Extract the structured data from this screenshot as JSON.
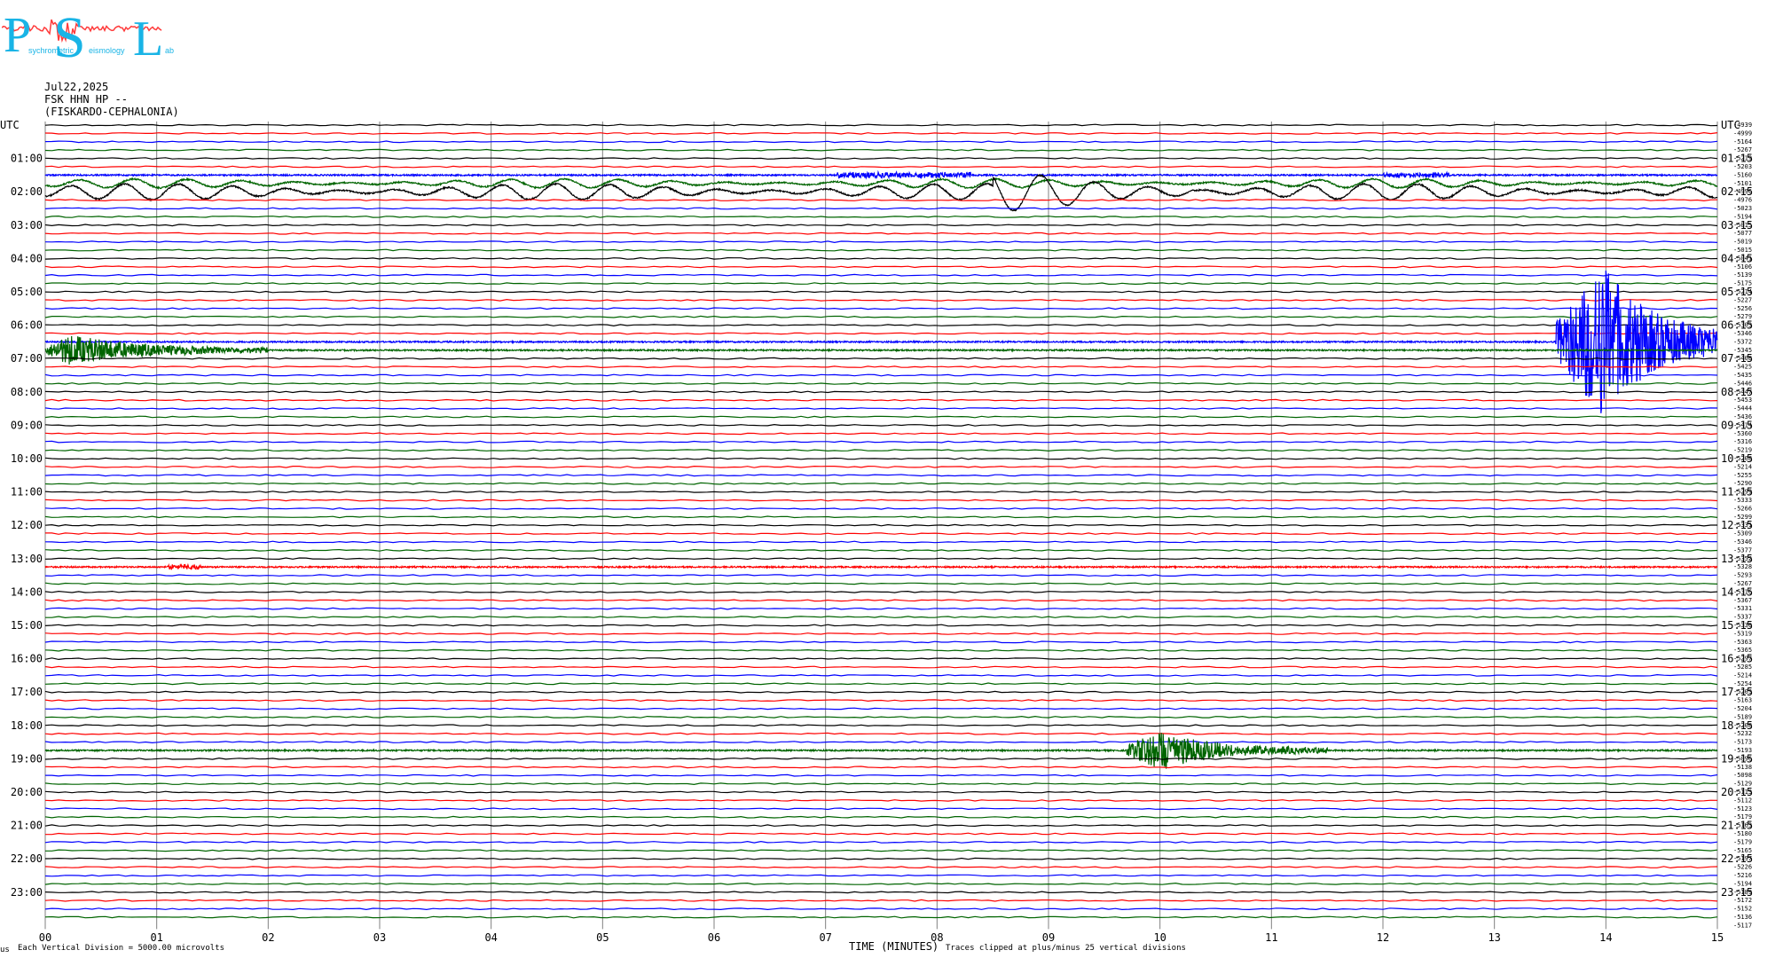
{
  "logo": {
    "letters": [
      "P",
      "S",
      "L"
    ],
    "words": [
      "sychrometric",
      "eismology",
      "ab"
    ]
  },
  "header": {
    "date": "Jul22,2025",
    "station": "FSK HHN HP --",
    "location": "(FISKARDO-CEPHALONIA)"
  },
  "utc_label": "UTC",
  "footer": {
    "scale": "Each Vertical Division = 5000.00 microvolts",
    "xlabel": "TIME (MINUTES)",
    "clip": "Traces clipped at plus/minus 25 vertical divisions",
    "corner": "us"
  },
  "colors": {
    "trace_cycle": [
      "#000000",
      "#ff0000",
      "#0000ff",
      "#006400"
    ],
    "grid": "#808080"
  },
  "chart_data": {
    "type": "line",
    "title": "",
    "xlabel": "TIME (MINUTES)",
    "xlim": [
      0,
      15
    ],
    "x_ticks": [
      "00",
      "01",
      "02",
      "03",
      "04",
      "05",
      "06",
      "07",
      "08",
      "09",
      "10",
      "11",
      "12",
      "13",
      "14",
      "15"
    ],
    "trace_count": 96,
    "left_hour_labels": [
      "UTC",
      "01:00",
      "02:00",
      "03:00",
      "04:00",
      "05:00",
      "06:00",
      "07:00",
      "08:00",
      "09:00",
      "10:00",
      "11:00",
      "12:00",
      "13:00",
      "14:00",
      "15:00",
      "16:00",
      "17:00",
      "18:00",
      "19:00",
      "20:00",
      "21:00",
      "22:00",
      "23:00"
    ],
    "right_hour_labels": [
      "UTC",
      "01:15",
      "02:15",
      "03:15",
      "04:15",
      "05:15",
      "06:15",
      "07:15",
      "08:15",
      "09:15",
      "10:15",
      "11:15",
      "12:15",
      "13:15",
      "14:15",
      "15:15",
      "16:15",
      "17:15",
      "18:15",
      "19:15",
      "20:15",
      "21:15",
      "22:15",
      "23:15"
    ],
    "right_values": [
      "-4939",
      "-4999",
      "-5164",
      "-5267",
      "-5219",
      "-5203",
      "-5160",
      "-5101",
      "-4996",
      "-4976",
      "-5023",
      "-5194",
      "-5015",
      "-5077",
      "-5019",
      "-5015",
      "-5041",
      "-5106",
      "-5139",
      "-5175",
      "-5214",
      "-5227",
      "-5256",
      "-5279",
      "-5303",
      "-5346",
      "-5372",
      "-5345",
      "-5408",
      "-5425",
      "-5435",
      "-5446",
      "-5447",
      "-5453",
      "-5444",
      "-5436",
      "-5414",
      "-5360",
      "-5316",
      "-5219",
      "-5208",
      "-5214",
      "-5255",
      "-5290",
      "-5299",
      "-5333",
      "-5266",
      "-5299",
      "-5331",
      "-5309",
      "-5346",
      "-5377",
      "-5352",
      "-5328",
      "-5293",
      "-5267",
      "-5316",
      "-5367",
      "-5331",
      "-5337",
      "-5330",
      "-5319",
      "-5363",
      "-5365",
      "-5297",
      "-5285",
      "-5214",
      "-5254",
      "-5203",
      "-5163",
      "-5204",
      "-5189",
      "-5208",
      "-5232",
      "-5173",
      "-5193",
      "-5096",
      "-5138",
      "-5098",
      "-5129",
      "-5113",
      "-5112",
      "-5123",
      "-5179",
      "-5163",
      "-5180",
      "-5179",
      "-5165",
      "-5197",
      "-5226",
      "-5216",
      "-5194",
      "-5189",
      "-5172",
      "-5152",
      "-5136",
      "-5117"
    ],
    "events": [
      {
        "trace": 6,
        "start_min": 7.1,
        "end_min": 8.3,
        "amplitude": 6,
        "kind": "noise"
      },
      {
        "trace": 6,
        "start_min": 12.0,
        "end_min": 12.6,
        "amplitude": 5,
        "kind": "noise"
      },
      {
        "trace": 7,
        "start_min": 0.0,
        "end_min": 15.0,
        "amplitude": 5,
        "kind": "swell"
      },
      {
        "trace": 8,
        "start_min": 0.0,
        "end_min": 15.0,
        "amplitude": 9,
        "kind": "swell"
      },
      {
        "trace": 8,
        "start_min": 8.5,
        "end_min": 10.3,
        "amplitude": 14,
        "kind": "swell"
      },
      {
        "trace": 26,
        "start_min": 13.55,
        "end_min": 15.0,
        "amplitude": 85,
        "kind": "quake",
        "peak_min": 13.95
      },
      {
        "trace": 27,
        "start_min": 0.0,
        "end_min": 2.0,
        "amplitude": 16,
        "kind": "coda",
        "peak_min": 0.2
      },
      {
        "trace": 53,
        "start_min": 1.1,
        "end_min": 1.4,
        "amplitude": 5,
        "kind": "noise"
      },
      {
        "trace": 75,
        "start_min": 9.7,
        "end_min": 11.5,
        "amplitude": 22,
        "kind": "quake",
        "peak_min": 10.0
      }
    ]
  }
}
